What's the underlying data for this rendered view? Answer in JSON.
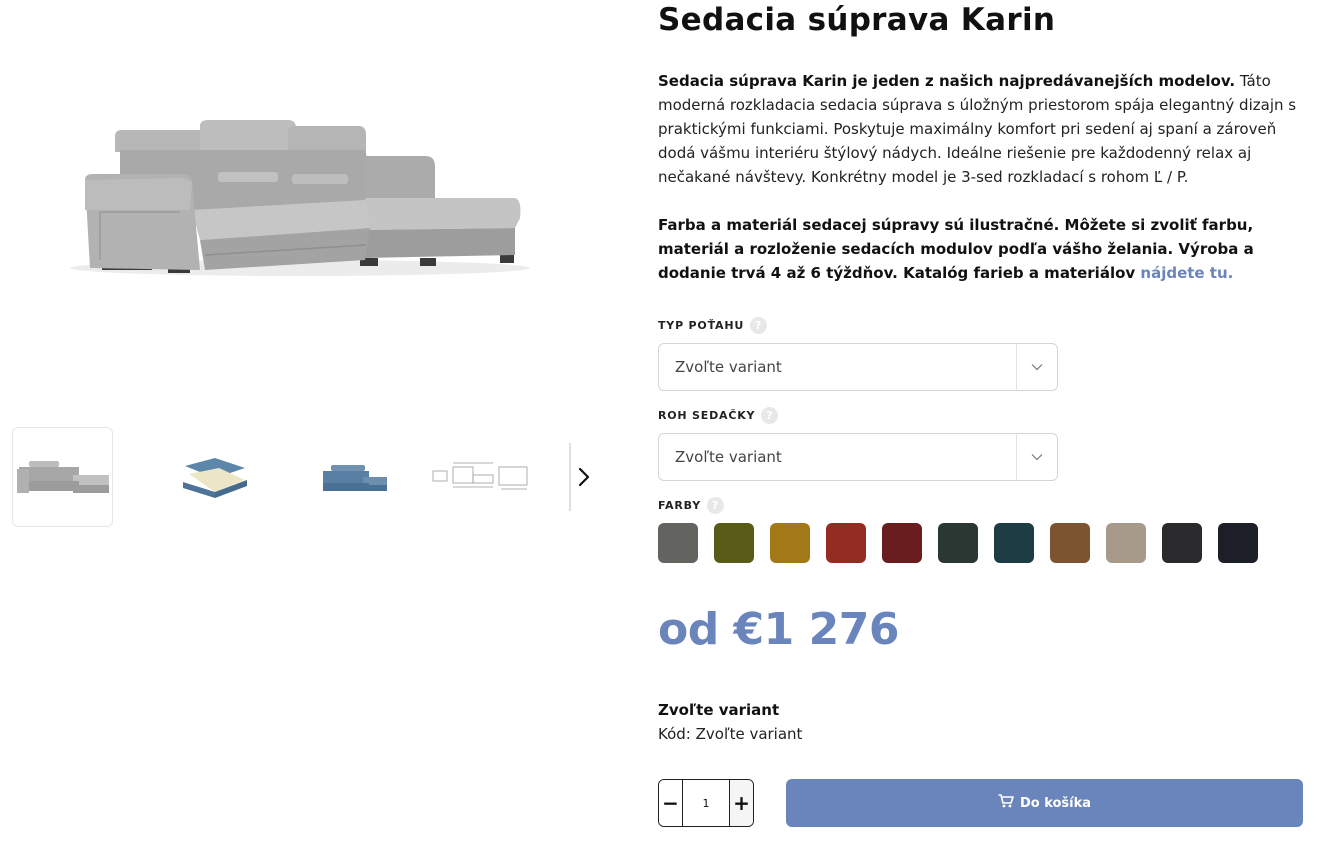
{
  "product": {
    "title": "Sedacia súprava Karin",
    "desc_p1_bold": "Sedacia súprava Karin je jeden z našich najpredávanejších modelov.",
    "desc_p1_rest": " Táto moderná rozkladacia sedacia súprava s úložným priestorom spája elegantný dizajn s praktickými funkciami. Poskytuje maximálny komfort pri sedení aj spaní a zároveň dodá vášmu interiéru štýlový nádych. Ideálne riešenie pre každodenný relax aj nečakané návštevy. Konkrétny model je 3-sed rozkladací s rohom Ľ / P.",
    "desc_p2_bold": "Farba a materiál sedacej súpravy sú ilustračné. Môžete si zvoliť farbu, materiál a rozloženie sedacích modulov podľa vášho želania. Výroba a dodanie trvá 4 až 6 týždňov. Katalóg farieb a materiálov ",
    "desc_p2_link": "nájdete tu."
  },
  "options": {
    "typ_potahu": {
      "label": "TYP POŤAHU",
      "value": "Zvoľte variant"
    },
    "roh_sedacky": {
      "label": "ROH SEDAČKY",
      "value": "Zvoľte variant"
    },
    "farby": {
      "label": "FARBY",
      "colors": [
        "#63645f",
        "#5a5a18",
        "#a27916",
        "#952c24",
        "#6a1d1f",
        "#2b3733",
        "#1e3c44",
        "#7c5530",
        "#a89a8a",
        "#2a2a2c",
        "#1c1f27"
      ]
    },
    "help_glyph": "?"
  },
  "price": {
    "text": "od €1 276"
  },
  "variant": {
    "title": "Zvoľte variant",
    "code": "Kód: Zvoľte variant"
  },
  "cart": {
    "quantity": "1",
    "minus": "−",
    "plus": "+",
    "button_label": "Do košíka"
  },
  "gallery": {
    "thumbnail_count": 4,
    "active_index": 0
  },
  "theme": {
    "accent": "#6a85bb"
  }
}
